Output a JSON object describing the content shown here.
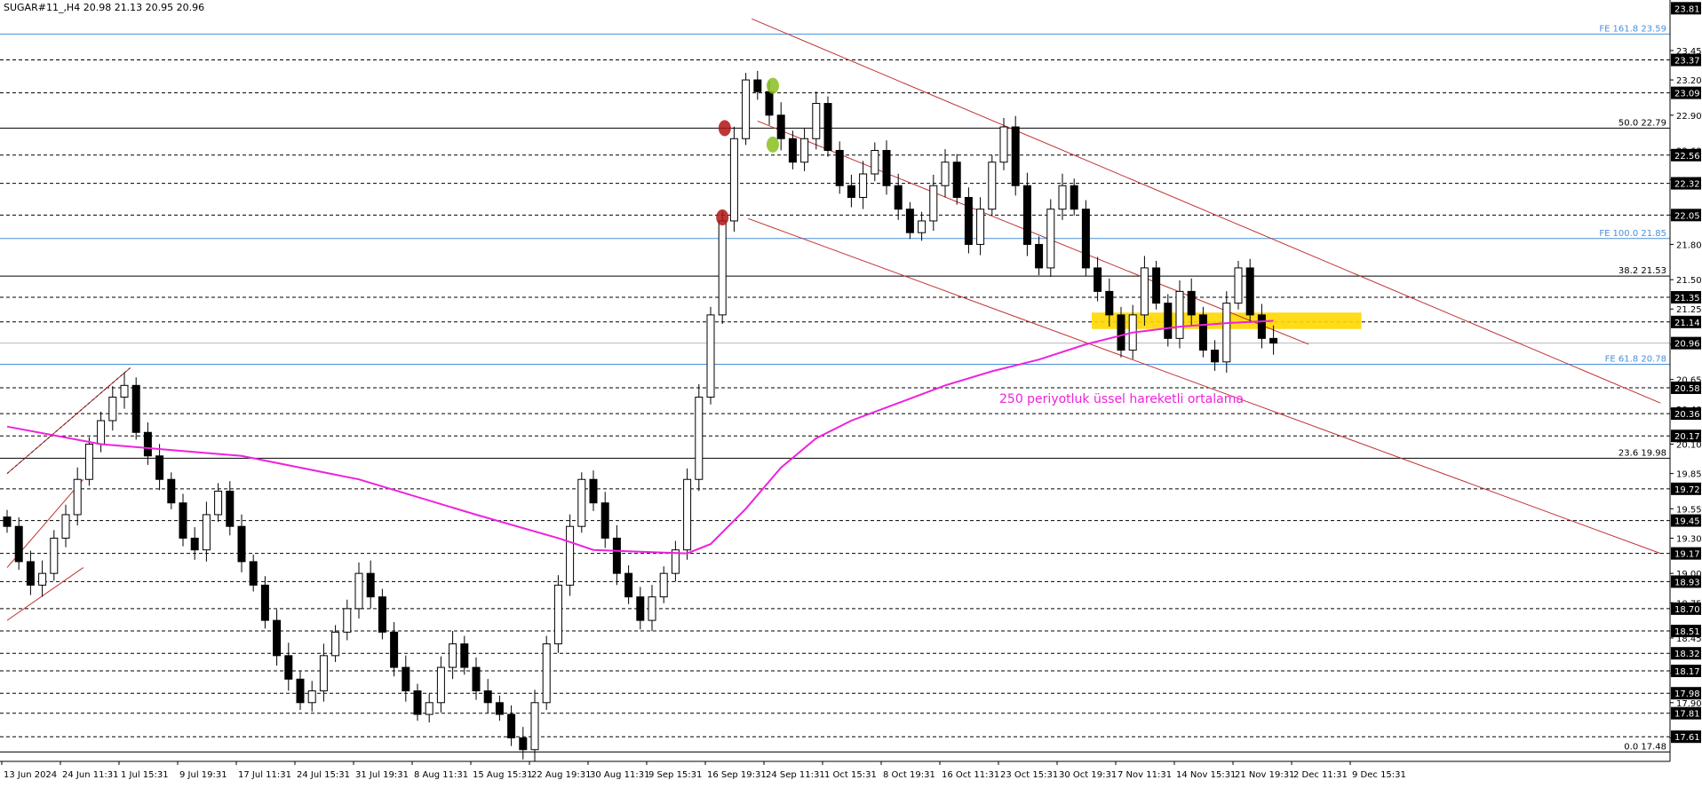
{
  "header": {
    "symbol_ohlc": "SUGAR#11_,H4  20.98 21.13 20.95 20.96"
  },
  "annotation": {
    "ema_label": "250 periyotluk üssel hareketli ortalama"
  },
  "colors": {
    "candle": "#000000",
    "ema": "#ee22dd",
    "channel": "#c03030",
    "fib_blue": "#4a90d9",
    "fib_black": "#000000",
    "support_zone": "#ffd700",
    "marker_red": "#b01515",
    "marker_green": "#88c020",
    "price_tag": "#000000"
  },
  "chart_data": {
    "type": "candlestick",
    "ylim": [
      17.4,
      23.85
    ],
    "x_labels": [
      "13 Jun 2024",
      "24 Jun 11:31",
      "1 Jul 15:31",
      "9 Jul 19:31",
      "17 Jul 11:31",
      "24 Jul 15:31",
      "31 Jul 19:31",
      "8 Aug 11:31",
      "15 Aug 15:31",
      "22 Aug 19:31",
      "30 Aug 11:31",
      "9 Sep 15:31",
      "16 Sep 19:31",
      "24 Sep 11:31",
      "1 Oct 15:31",
      "8 Oct 19:31",
      "16 Oct 11:31",
      "23 Oct 15:31",
      "30 Oct 19:31",
      "7 Nov 11:31",
      "14 Nov 15:31",
      "21 Nov 19:31",
      "2 Dec 11:31",
      "9 Dec 15:31"
    ],
    "y_ticks": [
      23.45,
      23.2,
      22.9,
      22.6,
      22.35,
      22.05,
      21.8,
      21.5,
      21.25,
      20.95,
      20.65,
      20.4,
      20.1,
      19.85,
      19.55,
      19.3,
      19.0,
      18.75,
      18.45,
      18.15,
      17.9,
      17.6
    ],
    "price_tags": [
      "23.81",
      "23.37",
      "23.09",
      "22.56",
      "22.32",
      "22.05",
      "21.35",
      "21.14",
      "20.96",
      "20.58",
      "20.36",
      "20.17",
      "19.72",
      "19.45",
      "19.17",
      "18.93",
      "18.70",
      "18.51",
      "18.32",
      "18.17",
      "17.98",
      "17.81",
      "17.61"
    ],
    "dashed_levels": [
      23.37,
      23.09,
      22.56,
      22.32,
      22.05,
      21.35,
      21.14,
      20.58,
      20.36,
      20.17,
      19.72,
      19.45,
      19.17,
      18.93,
      18.7,
      18.51,
      18.32,
      18.17,
      17.98,
      17.81,
      17.61
    ],
    "fib_levels": [
      {
        "label": "FE 161.8 23.59",
        "value": 23.59,
        "color": "blue"
      },
      {
        "label": "50.0 22.79",
        "value": 22.79,
        "color": "black"
      },
      {
        "label": "FE 100.0 21.85",
        "value": 21.85,
        "color": "blue"
      },
      {
        "label": "38.2 21.53",
        "value": 21.53,
        "color": "black"
      },
      {
        "label": "FE 61.8 20.78",
        "value": 20.78,
        "color": "blue"
      },
      {
        "label": "23.6 19.98",
        "value": 19.98,
        "color": "black"
      },
      {
        "label": "0.0 17.48",
        "value": 17.48,
        "color": "black"
      }
    ],
    "current_price": 20.96,
    "closes": [
      19.4,
      19.1,
      18.9,
      19.0,
      19.3,
      19.5,
      19.8,
      20.1,
      20.3,
      20.5,
      20.6,
      20.2,
      20.0,
      19.8,
      19.6,
      19.3,
      19.2,
      19.5,
      19.7,
      19.4,
      19.1,
      18.9,
      18.6,
      18.3,
      18.1,
      17.9,
      18.0,
      18.3,
      18.5,
      18.7,
      19.0,
      18.8,
      18.5,
      18.2,
      18.0,
      17.8,
      17.9,
      18.2,
      18.4,
      18.2,
      18.0,
      17.9,
      17.8,
      17.6,
      17.5,
      17.9,
      18.4,
      18.9,
      19.4,
      19.8,
      19.6,
      19.3,
      19.0,
      18.8,
      18.6,
      18.8,
      19.0,
      19.2,
      19.8,
      20.5,
      21.2,
      22.0,
      22.7,
      23.2,
      23.1,
      22.9,
      22.7,
      22.5,
      22.7,
      23.0,
      22.6,
      22.3,
      22.2,
      22.4,
      22.6,
      22.3,
      22.1,
      21.9,
      22.0,
      22.3,
      22.5,
      22.2,
      21.8,
      22.1,
      22.5,
      22.8,
      22.3,
      21.8,
      21.6,
      22.1,
      22.3,
      22.1,
      21.6,
      21.4,
      21.2,
      20.9,
      21.2,
      21.6,
      21.3,
      21.0,
      21.4,
      21.2,
      20.9,
      20.8,
      21.3,
      21.6,
      21.2,
      21.0,
      20.96
    ],
    "ema": [
      {
        "bar": 0,
        "value": 20.25
      },
      {
        "bar": 8,
        "value": 20.1
      },
      {
        "bar": 20,
        "value": 20.0
      },
      {
        "bar": 30,
        "value": 19.8
      },
      {
        "bar": 40,
        "value": 19.5
      },
      {
        "bar": 47,
        "value": 19.3
      },
      {
        "bar": 50,
        "value": 19.2
      },
      {
        "bar": 55,
        "value": 19.18
      },
      {
        "bar": 58,
        "value": 19.17
      },
      {
        "bar": 60,
        "value": 19.25
      },
      {
        "bar": 63,
        "value": 19.55
      },
      {
        "bar": 66,
        "value": 19.9
      },
      {
        "bar": 69,
        "value": 20.15
      },
      {
        "bar": 72,
        "value": 20.3
      },
      {
        "bar": 76,
        "value": 20.45
      },
      {
        "bar": 80,
        "value": 20.6
      },
      {
        "bar": 84,
        "value": 20.72
      },
      {
        "bar": 88,
        "value": 20.82
      },
      {
        "bar": 92,
        "value": 20.95
      },
      {
        "bar": 96,
        "value": 21.05
      },
      {
        "bar": 100,
        "value": 21.1
      },
      {
        "bar": 104,
        "value": 21.13
      },
      {
        "bar": 108,
        "value": 21.15
      }
    ],
    "channel_lines": [
      {
        "from": {
          "bar": 63.5,
          "value": 23.72
        },
        "to": {
          "bar": 141,
          "value": 20.45
        }
      },
      {
        "from": {
          "bar": 63.2,
          "value": 22.02
        },
        "to": {
          "bar": 141,
          "value": 19.17
        }
      },
      {
        "from": {
          "bar": 64,
          "value": 22.85
        },
        "to": {
          "bar": 111,
          "value": 20.95
        }
      },
      {
        "from": {
          "bar": 0,
          "value": 19.05
        },
        "to": {
          "bar": 6.5,
          "value": 19.8
        }
      },
      {
        "from": {
          "bar": 0,
          "value": 18.6
        },
        "to": {
          "bar": 6.5,
          "value": 19.05
        }
      },
      {
        "from": {
          "bar": 0,
          "value": 19.85
        },
        "to": {
          "bar": 10.5,
          "value": 20.75
        }
      }
    ],
    "support_zone": {
      "bar_from": 92.5,
      "bar_to": 115.5,
      "top": 21.22,
      "bottom": 21.08
    },
    "markers": [
      {
        "bar": 61,
        "value": 22.03,
        "color": "red"
      },
      {
        "bar": 61.2,
        "value": 22.79,
        "color": "red"
      },
      {
        "bar": 65.3,
        "value": 23.15,
        "color": "green"
      },
      {
        "bar": 65.3,
        "value": 22.65,
        "color": "green"
      }
    ]
  }
}
